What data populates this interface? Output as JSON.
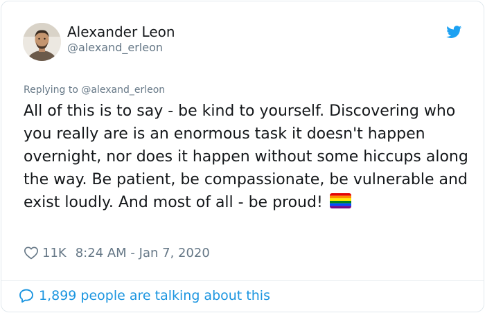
{
  "author": {
    "display_name": "Alexander Leon",
    "handle": "@alexand_erleon",
    "avatar_icon": "user-photo"
  },
  "platform_icon": "twitter-bird-icon",
  "brand_color": "#1DA1F2",
  "reply": {
    "prefix": "Replying to ",
    "to_handle": "@alexand_erleon"
  },
  "tweet": {
    "text": "All of this is to say - be kind to yourself. Discovering who you really are is an enormous task it doesn't happen overnight, nor does it happen without some hiccups along the way. Be patient, be compassionate, be vulnerable and exist loudly. And most of all - be proud!",
    "emoji": "rainbow-flag-icon"
  },
  "stats": {
    "likes": "11K",
    "timestamp": "8:24 AM - Jan 7, 2020"
  },
  "footer": {
    "talking_label": "1,899 people are talking about this"
  }
}
